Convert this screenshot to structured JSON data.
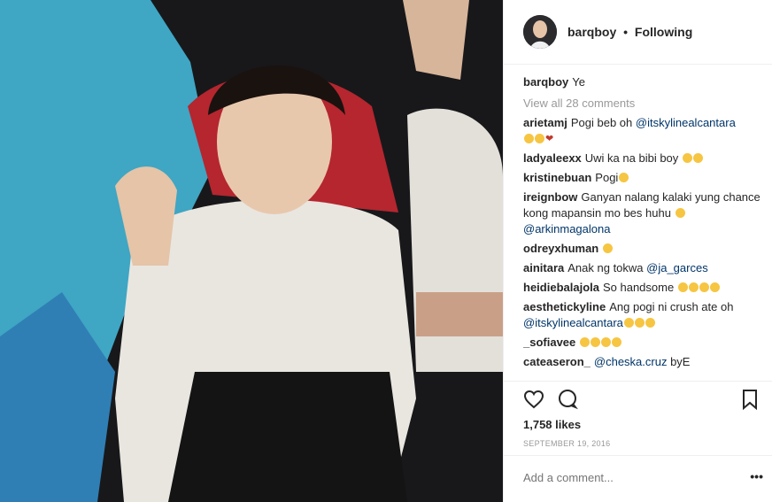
{
  "post": {
    "username": "barqboy",
    "separator": "•",
    "follow_status": "Following",
    "caption": {
      "user": "barqboy",
      "text": "Ye"
    },
    "view_all": "View all 28 comments",
    "comments": [
      {
        "user": "arietamj",
        "parts": [
          {
            "t": "text",
            "v": "Pogi beb oh "
          },
          {
            "t": "mention",
            "v": "@itskylinealcantara"
          }
        ],
        "emojis_newline": [
          "smile",
          "smile",
          "heart"
        ]
      },
      {
        "user": "ladyaleexx",
        "parts": [
          {
            "t": "text",
            "v": "Uwi ka na bibi boy "
          }
        ],
        "emojis": [
          "smile",
          "smile"
        ]
      },
      {
        "user": "kristinebuan",
        "parts": [
          {
            "t": "text",
            "v": "Pogi"
          }
        ],
        "emojis": [
          "smile"
        ]
      },
      {
        "user": "ireignbow",
        "parts": [
          {
            "t": "text",
            "v": "Ganyan nalang kalaki yung chance kong mapansin mo bes huhu "
          }
        ],
        "emojis": [
          "smile"
        ],
        "mention_newline": "@arkinmagalona"
      },
      {
        "user": "odreyxhuman",
        "parts": [],
        "emojis": [
          "smile"
        ]
      },
      {
        "user": "ainitara",
        "parts": [
          {
            "t": "text",
            "v": "Anak ng tokwa "
          },
          {
            "t": "mention",
            "v": "@ja_garces"
          }
        ]
      },
      {
        "user": "heidiebalajola",
        "parts": [
          {
            "t": "text",
            "v": "So handsome "
          }
        ],
        "emojis": [
          "smile",
          "smile",
          "smile",
          "smile"
        ]
      },
      {
        "user": "aesthetickyline",
        "parts": [
          {
            "t": "text",
            "v": "Ang pogi ni crush ate oh "
          }
        ],
        "mention_newline": "@itskylinealcantara",
        "emojis_after_mention": [
          "smile",
          "smile",
          "smile"
        ]
      },
      {
        "user": "_sofiavee",
        "parts": [],
        "emojis": [
          "smile",
          "smile",
          "smile",
          "smile"
        ]
      },
      {
        "user": "cateaseron_",
        "parts": [
          {
            "t": "mention",
            "v": "@cheska.cruz"
          },
          {
            "t": "text",
            "v": " byE"
          }
        ]
      }
    ],
    "likes": "1,758 likes",
    "date": "SEPTEMBER 19, 2016",
    "add_comment_placeholder": "Add a comment...",
    "more_label": "•••",
    "icons": {
      "like": "heart-outline-icon",
      "comment": "speech-bubble-icon",
      "save": "bookmark-icon"
    },
    "colors": {
      "text": "#262626",
      "muted": "#999999",
      "mention": "#003569",
      "divider": "#efefef"
    }
  }
}
